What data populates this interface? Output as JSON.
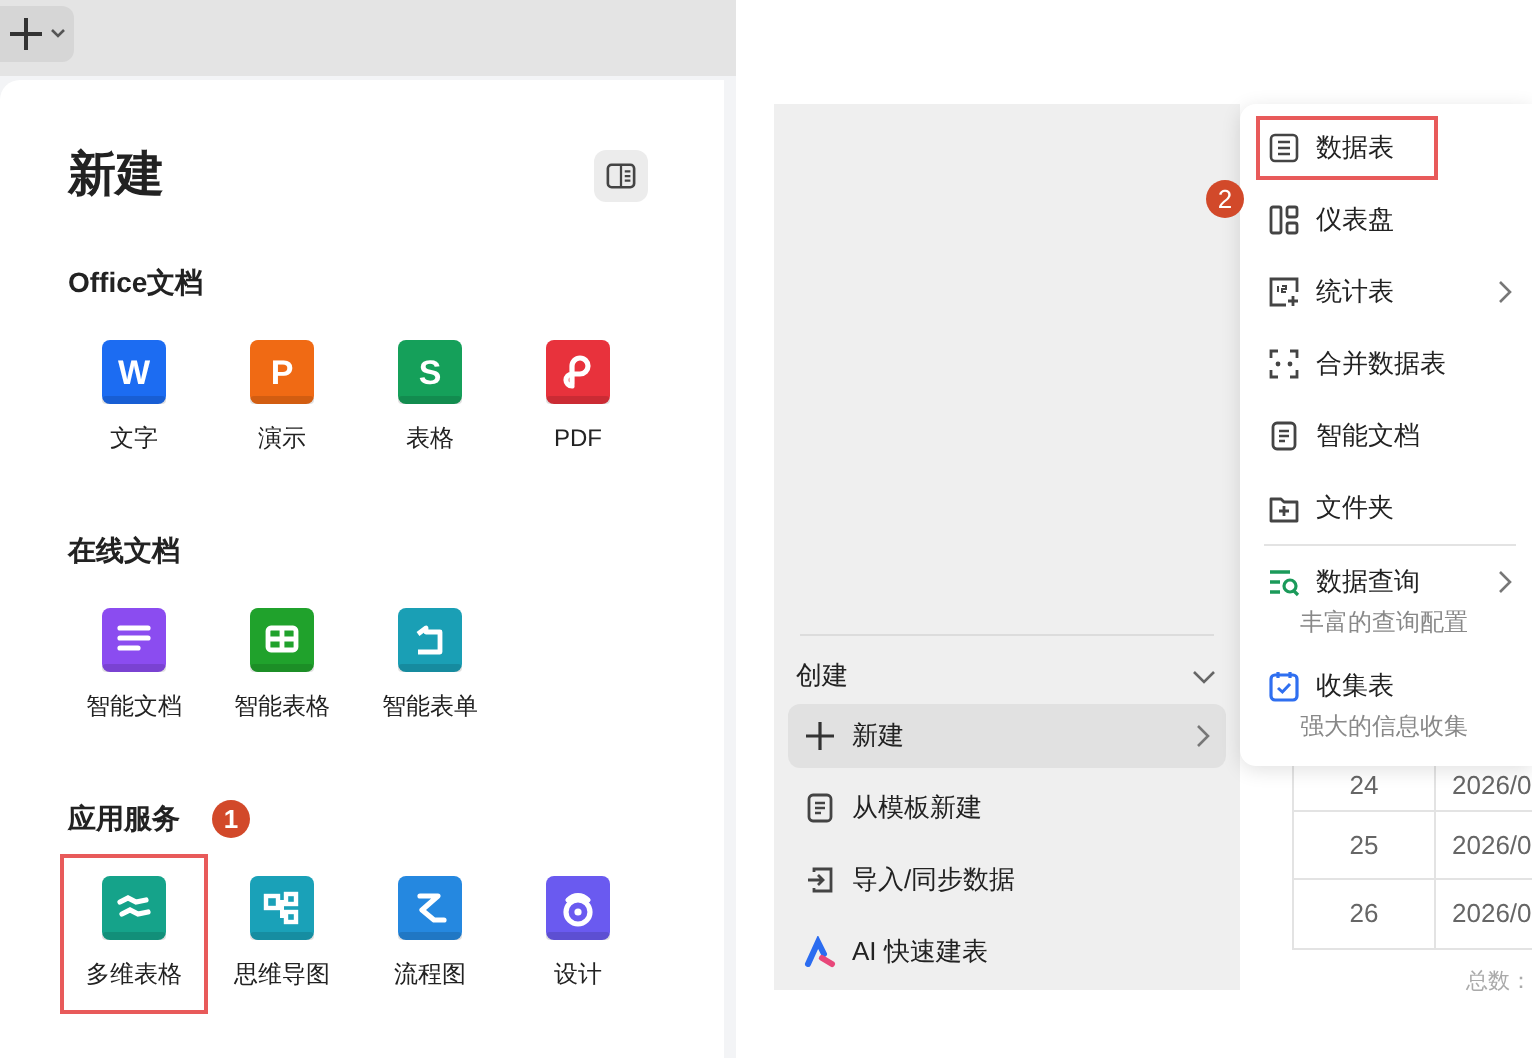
{
  "tab_bar": {
    "new_tab_button": true,
    "dropdown": true
  },
  "new_panel": {
    "title": "新建",
    "sections": [
      {
        "heading": "Office文档",
        "items": [
          {
            "label": "文字",
            "kind": "word",
            "glyph": "W",
            "highlighted": false
          },
          {
            "label": "演示",
            "kind": "presentation",
            "glyph": "P",
            "highlighted": false
          },
          {
            "label": "表格",
            "kind": "spreadsheet",
            "glyph": "S",
            "highlighted": false
          },
          {
            "label": "PDF",
            "kind": "pdf",
            "highlighted": false
          }
        ]
      },
      {
        "heading": "在线文档",
        "items": [
          {
            "label": "智能文档",
            "kind": "smart-doc",
            "highlighted": false
          },
          {
            "label": "智能表格",
            "kind": "smart-sheet",
            "highlighted": false
          },
          {
            "label": "智能表单",
            "kind": "smart-form",
            "highlighted": false
          }
        ]
      },
      {
        "heading": "应用服务",
        "callout": "1",
        "items": [
          {
            "label": "多维表格",
            "kind": "multi-table",
            "highlighted": true
          },
          {
            "label": "思维导图",
            "kind": "mind-map",
            "highlighted": false
          },
          {
            "label": "流程图",
            "kind": "flowchart",
            "highlighted": false
          },
          {
            "label": "设计",
            "kind": "design",
            "highlighted": false
          }
        ]
      }
    ]
  },
  "sidebar": {
    "section": {
      "label": "创建",
      "expanded": true
    },
    "items": [
      {
        "label": "新建",
        "kind": "plus",
        "selected": true,
        "submenu": true
      },
      {
        "label": "从模板新建",
        "kind": "template",
        "selected": false,
        "submenu": false
      },
      {
        "label": "导入/同步数据",
        "kind": "import",
        "selected": false,
        "submenu": false
      },
      {
        "label": "AI 快速建表",
        "kind": "ai",
        "selected": false,
        "submenu": false
      }
    ]
  },
  "new_menu": {
    "callout": "2",
    "items": [
      {
        "label": "数据表",
        "kind": "table",
        "highlighted": true,
        "submenu": false
      },
      {
        "label": "仪表盘",
        "kind": "dashboard",
        "highlighted": false,
        "submenu": false
      },
      {
        "label": "统计表",
        "kind": "chart",
        "highlighted": false,
        "submenu": true
      },
      {
        "label": "合并数据表",
        "kind": "merge",
        "highlighted": false,
        "submenu": false
      },
      {
        "label": "智能文档",
        "kind": "doc",
        "highlighted": false,
        "submenu": false
      },
      {
        "label": "文件夹",
        "kind": "folder",
        "highlighted": false,
        "submenu": false
      },
      {
        "label": "数据查询",
        "kind": "query",
        "description": "丰富的查询配置",
        "highlighted": false,
        "submenu": true,
        "divider_before": true
      },
      {
        "label": "收集表",
        "kind": "form",
        "description": "强大的信息收集",
        "highlighted": false,
        "submenu": false
      }
    ]
  },
  "table": {
    "rows": [
      {
        "cells": [
          "24",
          "2026/0"
        ]
      },
      {
        "cells": [
          "25",
          "2026/0"
        ]
      },
      {
        "cells": [
          "26",
          "2026/0"
        ]
      }
    ],
    "footer": "总数："
  }
}
